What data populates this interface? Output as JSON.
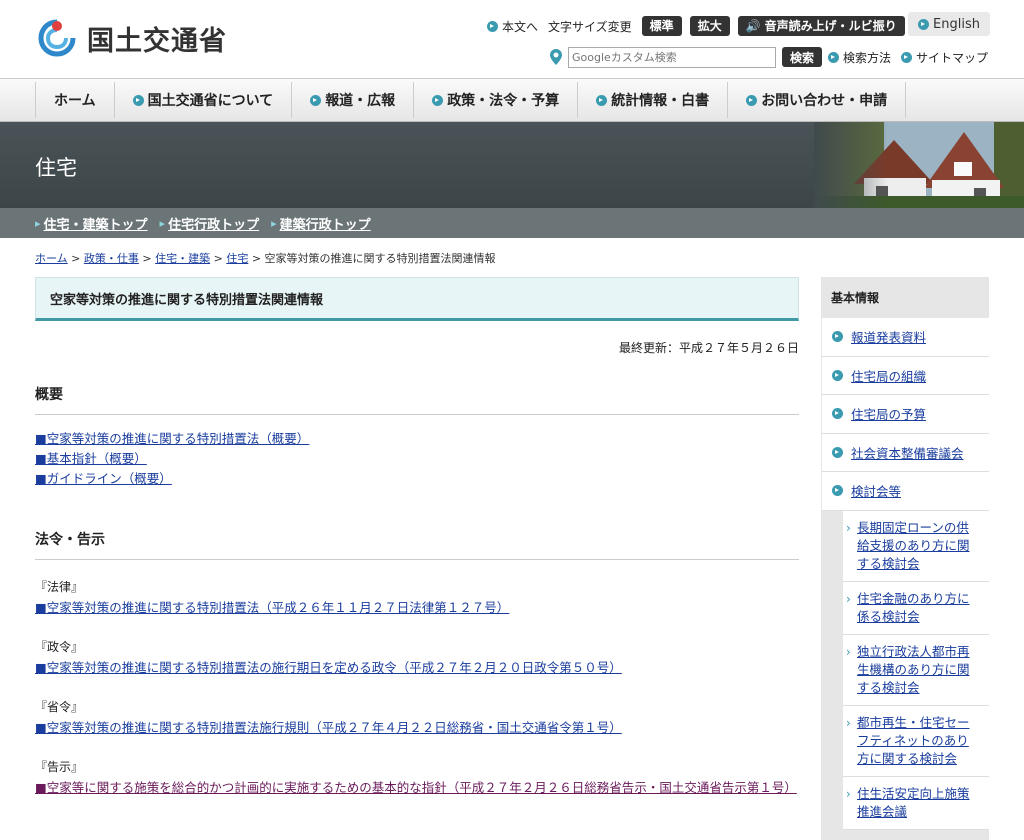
{
  "header": {
    "logo_text": "国土交通省",
    "util": {
      "skip": "本文へ",
      "font_size_label": "文字サイズ変更",
      "standard": "標準",
      "large": "拡大",
      "voice": "音声読み上げ・ルビ振り"
    },
    "english": "English",
    "search": {
      "placeholder": "Googleカスタム検索",
      "button": "検索",
      "method": "検索方法",
      "sitemap": "サイトマップ"
    }
  },
  "nav": {
    "items": [
      "ホーム",
      "国土交通省について",
      "報道・広報",
      "政策・法令・予算",
      "統計情報・白書",
      "お問い合わせ・申請"
    ]
  },
  "banner": {
    "title": "住宅",
    "subnav": [
      "住宅・建築トップ",
      "住宅行政トップ",
      "建築行政トップ"
    ]
  },
  "breadcrumb": {
    "items": [
      "ホーム",
      "政策・仕事",
      "住宅・建築",
      "住宅"
    ],
    "current": "空家等対策の推進に関する特別措置法関連情報"
  },
  "main": {
    "heading": "空家等対策の推進に関する特別措置法関連情報",
    "last_updated": "最終更新：平成２７年５月２６日",
    "overview": {
      "title": "概要",
      "links": [
        "■空家等対策の推進に関する特別措置法（概要）",
        "■基本指針（概要）",
        "■ガイドライン（概要）"
      ]
    },
    "laws": {
      "title": "法令・告示",
      "groups": [
        {
          "label": "『法律』",
          "link": "■空家等対策の推進に関する特別措置法（平成２６年１１月２７日法律第１２７号）"
        },
        {
          "label": "『政令』",
          "link": "■空家等対策の推進に関する特別措置法の施行期日を定める政令（平成２７年２月２０日政令第５０号）"
        },
        {
          "label": "『省令』",
          "link": "■空家等対策の推進に関する特別措置法施行規則（平成２７年４月２２日総務省・国土交通省令第１号）"
        },
        {
          "label": "『告示』",
          "link": "■空家等に関する施策を総合的かつ計画的に実施するための基本的な指針（平成２７年２月２６日総務省告示・国土交通省告示第１号）"
        }
      ]
    }
  },
  "side": {
    "title": "基本情報",
    "items": [
      "報道発表資料",
      "住宅局の組織",
      "住宅局の予算",
      "社会資本整備審議会",
      "検討会等"
    ],
    "subitems": [
      "長期固定ローンの供給支援のあり方に関する検討会",
      "住宅金融のあり方に係る検討会",
      "独立行政法人都市再生機構のあり方に関する検討会",
      "都市再生・住宅セーフティネットのあり方に関する検討会",
      "住生活安定向上施策推進会議"
    ]
  }
}
